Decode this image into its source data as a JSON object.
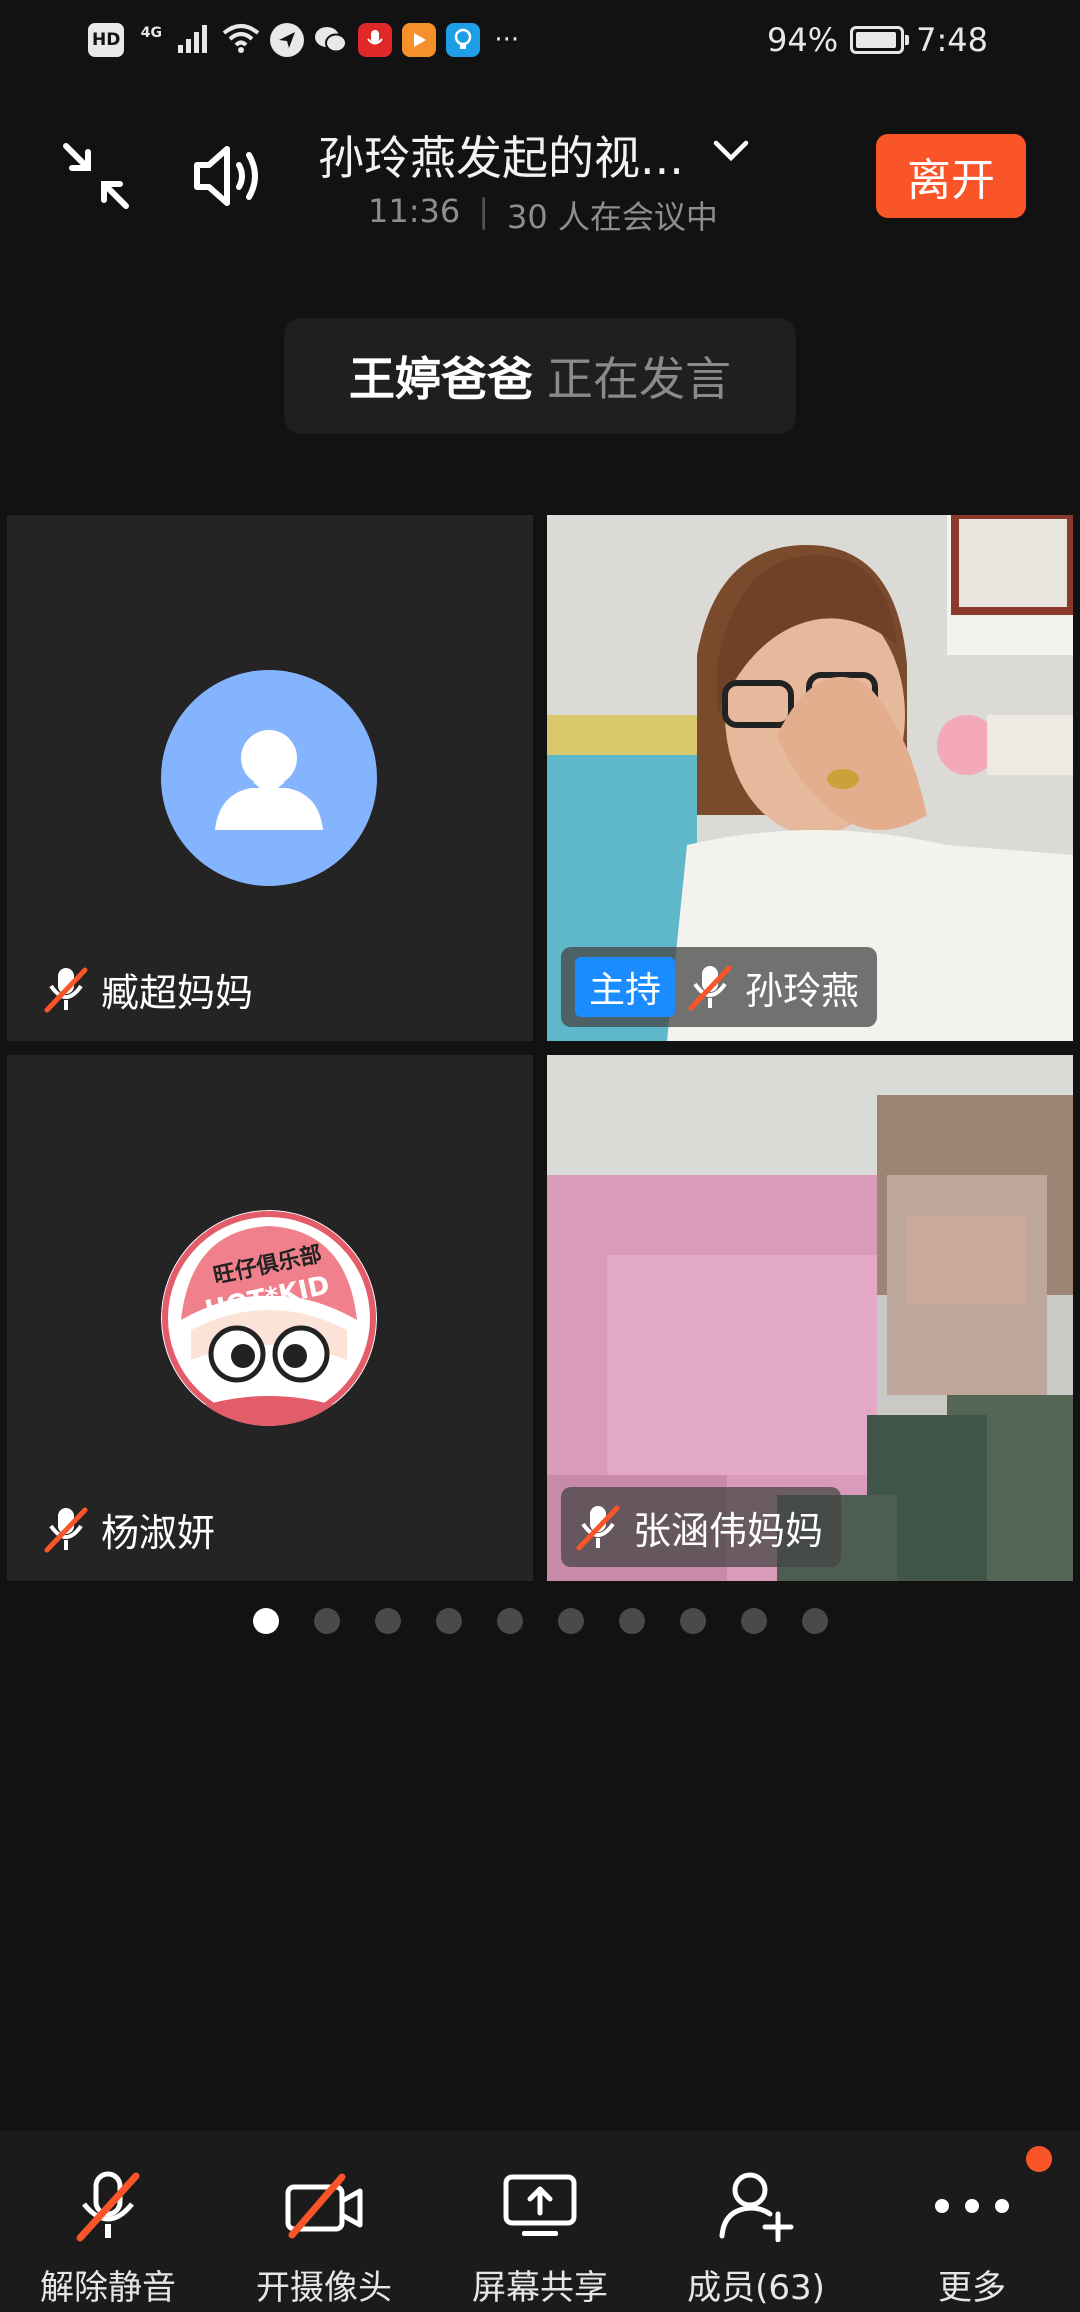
{
  "status_bar": {
    "hd": "HD",
    "network": "4G",
    "battery_text": "94%",
    "battery_level": 0.94,
    "time": "7:48",
    "more": "···"
  },
  "header": {
    "title": "孙玲燕发起的视...",
    "elapsed": "11:36",
    "separator": "|",
    "participants": "30 人在会议中",
    "leave_label": "离开"
  },
  "speaking": {
    "name": "王婷爸爸",
    "status": "正在发言"
  },
  "tiles": [
    {
      "name": "臧超妈妈",
      "muted": true,
      "host": false
    },
    {
      "name": "孙玲燕",
      "muted": true,
      "host": true,
      "host_label": "主持"
    },
    {
      "name": "杨淑妍",
      "muted": true,
      "host": false
    },
    {
      "name": "张涵伟妈妈",
      "muted": true,
      "host": false
    }
  ],
  "avatar_text": {
    "club": "旺仔俱乐部",
    "brand": "HOT*KID"
  },
  "pagination": {
    "pages": 10,
    "current": 1
  },
  "toolbar": {
    "unmute": "解除静音",
    "camera": "开摄像头",
    "share": "屏幕共享",
    "members": "成员(63)",
    "more": "更多"
  },
  "colors": {
    "accent": "#fa5528",
    "host_badge": "#1a8cff",
    "default_avatar": "#85b4ff",
    "background": "#121212"
  }
}
